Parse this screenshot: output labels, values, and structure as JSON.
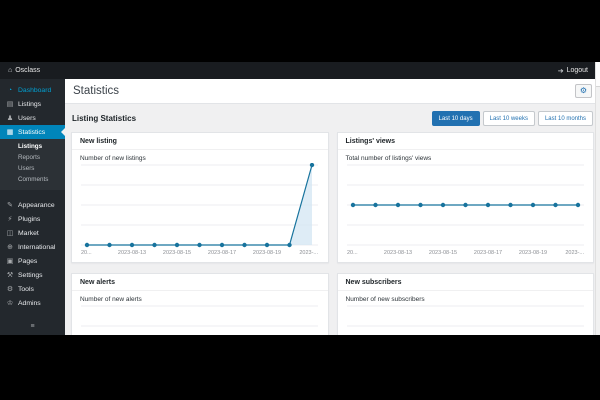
{
  "colors": {
    "accent": "#2271b1",
    "active_menu": "#0085ba",
    "highlight_link": "#00a0d2",
    "chart_line": "#17739d",
    "chart_fill": "#d3e6f3",
    "grid_line": "#eceef0",
    "axis_label": "#8c8f94"
  },
  "topbar": {
    "brand": "Osclass",
    "brand_icon": "home-icon",
    "logout_label": "Logout",
    "logout_icon": "logout-icon"
  },
  "sidebar": {
    "collapse_icon": "menu-icon",
    "items": [
      {
        "label": "Dashboard",
        "icon": "dashboard-icon",
        "highlight": true
      },
      {
        "label": "Listings",
        "icon": "listings-icon"
      },
      {
        "label": "Users",
        "icon": "users-icon"
      },
      {
        "label": "Statistics",
        "icon": "statistics-icon",
        "active": true,
        "submenu": [
          {
            "label": "Listings",
            "current": true
          },
          {
            "label": "Reports"
          },
          {
            "label": "Users"
          },
          {
            "label": "Comments"
          }
        ]
      },
      {
        "label": "Appearance",
        "icon": "appearance-icon",
        "section_gap": true
      },
      {
        "label": "Plugins",
        "icon": "plugins-icon"
      },
      {
        "label": "Market",
        "icon": "market-icon"
      },
      {
        "label": "International",
        "icon": "international-icon"
      },
      {
        "label": "Pages",
        "icon": "pages-icon"
      },
      {
        "label": "Settings",
        "icon": "settings-icon"
      },
      {
        "label": "Tools",
        "icon": "tools-icon"
      },
      {
        "label": "Admins",
        "icon": "admins-icon"
      }
    ]
  },
  "page": {
    "title": "Statistics",
    "options_icon": "gear-icon"
  },
  "section": {
    "title": "Listing Statistics",
    "filters": [
      {
        "label": "Last 10 days",
        "active": true
      },
      {
        "label": "Last 10 weeks",
        "active": false
      },
      {
        "label": "Last 10 months",
        "active": false
      }
    ]
  },
  "cards": [
    {
      "title": "New listing",
      "subtitle": "Number of new listings",
      "chart": {
        "type": "line",
        "values": [
          0,
          0,
          0,
          0,
          0,
          0,
          0,
          0,
          0,
          0,
          1
        ],
        "ymin": 0,
        "ymax": 1,
        "fill": true,
        "grid": true,
        "legend": false,
        "x_labels": [
          {
            "i": 0,
            "text": "20..."
          },
          {
            "i": 2,
            "text": "2023-08-13"
          },
          {
            "i": 4,
            "text": "2023-08-15"
          },
          {
            "i": 6,
            "text": "2023-08-17"
          },
          {
            "i": 8,
            "text": "2023-08-19"
          },
          {
            "i": 10,
            "text": "2023-..."
          }
        ]
      }
    },
    {
      "title": "Listings' views",
      "subtitle": "Total number of listings' views",
      "chart": {
        "type": "line",
        "values": [
          4,
          4,
          4,
          4,
          4,
          4,
          4,
          4,
          4,
          4,
          4
        ],
        "ymin": 0,
        "ymax": 8,
        "fill": false,
        "grid": true,
        "legend": false,
        "x_labels": [
          {
            "i": 0,
            "text": "20..."
          },
          {
            "i": 2,
            "text": "2023-08-13"
          },
          {
            "i": 4,
            "text": "2023-08-15"
          },
          {
            "i": 6,
            "text": "2023-08-17"
          },
          {
            "i": 8,
            "text": "2023-08-19"
          },
          {
            "i": 10,
            "text": "2023-..."
          }
        ]
      }
    },
    {
      "title": "New alerts",
      "subtitle": "Number of new alerts",
      "chart": {
        "type": "line",
        "values": [],
        "x_labels": [],
        "fill": false,
        "grid": true,
        "legend": false
      }
    },
    {
      "title": "New subscribers",
      "subtitle": "Number of new subscribers",
      "chart": {
        "type": "line",
        "values": [],
        "x_labels": [],
        "fill": false,
        "grid": true,
        "legend": false
      }
    }
  ]
}
